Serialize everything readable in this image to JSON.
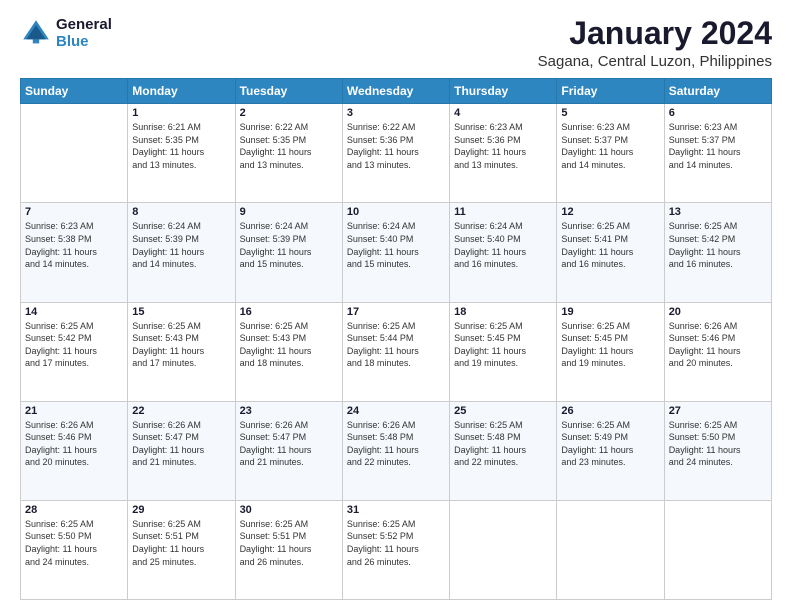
{
  "logo": {
    "line1": "General",
    "line2": "Blue"
  },
  "title": "January 2024",
  "subtitle": "Sagana, Central Luzon, Philippines",
  "days_header": [
    "Sunday",
    "Monday",
    "Tuesday",
    "Wednesday",
    "Thursday",
    "Friday",
    "Saturday"
  ],
  "weeks": [
    [
      {
        "num": "",
        "info": ""
      },
      {
        "num": "1",
        "info": "Sunrise: 6:21 AM\nSunset: 5:35 PM\nDaylight: 11 hours\nand 13 minutes."
      },
      {
        "num": "2",
        "info": "Sunrise: 6:22 AM\nSunset: 5:35 PM\nDaylight: 11 hours\nand 13 minutes."
      },
      {
        "num": "3",
        "info": "Sunrise: 6:22 AM\nSunset: 5:36 PM\nDaylight: 11 hours\nand 13 minutes."
      },
      {
        "num": "4",
        "info": "Sunrise: 6:23 AM\nSunset: 5:36 PM\nDaylight: 11 hours\nand 13 minutes."
      },
      {
        "num": "5",
        "info": "Sunrise: 6:23 AM\nSunset: 5:37 PM\nDaylight: 11 hours\nand 14 minutes."
      },
      {
        "num": "6",
        "info": "Sunrise: 6:23 AM\nSunset: 5:37 PM\nDaylight: 11 hours\nand 14 minutes."
      }
    ],
    [
      {
        "num": "7",
        "info": "Sunrise: 6:23 AM\nSunset: 5:38 PM\nDaylight: 11 hours\nand 14 minutes."
      },
      {
        "num": "8",
        "info": "Sunrise: 6:24 AM\nSunset: 5:39 PM\nDaylight: 11 hours\nand 14 minutes."
      },
      {
        "num": "9",
        "info": "Sunrise: 6:24 AM\nSunset: 5:39 PM\nDaylight: 11 hours\nand 15 minutes."
      },
      {
        "num": "10",
        "info": "Sunrise: 6:24 AM\nSunset: 5:40 PM\nDaylight: 11 hours\nand 15 minutes."
      },
      {
        "num": "11",
        "info": "Sunrise: 6:24 AM\nSunset: 5:40 PM\nDaylight: 11 hours\nand 16 minutes."
      },
      {
        "num": "12",
        "info": "Sunrise: 6:25 AM\nSunset: 5:41 PM\nDaylight: 11 hours\nand 16 minutes."
      },
      {
        "num": "13",
        "info": "Sunrise: 6:25 AM\nSunset: 5:42 PM\nDaylight: 11 hours\nand 16 minutes."
      }
    ],
    [
      {
        "num": "14",
        "info": "Sunrise: 6:25 AM\nSunset: 5:42 PM\nDaylight: 11 hours\nand 17 minutes."
      },
      {
        "num": "15",
        "info": "Sunrise: 6:25 AM\nSunset: 5:43 PM\nDaylight: 11 hours\nand 17 minutes."
      },
      {
        "num": "16",
        "info": "Sunrise: 6:25 AM\nSunset: 5:43 PM\nDaylight: 11 hours\nand 18 minutes."
      },
      {
        "num": "17",
        "info": "Sunrise: 6:25 AM\nSunset: 5:44 PM\nDaylight: 11 hours\nand 18 minutes."
      },
      {
        "num": "18",
        "info": "Sunrise: 6:25 AM\nSunset: 5:45 PM\nDaylight: 11 hours\nand 19 minutes."
      },
      {
        "num": "19",
        "info": "Sunrise: 6:25 AM\nSunset: 5:45 PM\nDaylight: 11 hours\nand 19 minutes."
      },
      {
        "num": "20",
        "info": "Sunrise: 6:26 AM\nSunset: 5:46 PM\nDaylight: 11 hours\nand 20 minutes."
      }
    ],
    [
      {
        "num": "21",
        "info": "Sunrise: 6:26 AM\nSunset: 5:46 PM\nDaylight: 11 hours\nand 20 minutes."
      },
      {
        "num": "22",
        "info": "Sunrise: 6:26 AM\nSunset: 5:47 PM\nDaylight: 11 hours\nand 21 minutes."
      },
      {
        "num": "23",
        "info": "Sunrise: 6:26 AM\nSunset: 5:47 PM\nDaylight: 11 hours\nand 21 minutes."
      },
      {
        "num": "24",
        "info": "Sunrise: 6:26 AM\nSunset: 5:48 PM\nDaylight: 11 hours\nand 22 minutes."
      },
      {
        "num": "25",
        "info": "Sunrise: 6:25 AM\nSunset: 5:48 PM\nDaylight: 11 hours\nand 22 minutes."
      },
      {
        "num": "26",
        "info": "Sunrise: 6:25 AM\nSunset: 5:49 PM\nDaylight: 11 hours\nand 23 minutes."
      },
      {
        "num": "27",
        "info": "Sunrise: 6:25 AM\nSunset: 5:50 PM\nDaylight: 11 hours\nand 24 minutes."
      }
    ],
    [
      {
        "num": "28",
        "info": "Sunrise: 6:25 AM\nSunset: 5:50 PM\nDaylight: 11 hours\nand 24 minutes."
      },
      {
        "num": "29",
        "info": "Sunrise: 6:25 AM\nSunset: 5:51 PM\nDaylight: 11 hours\nand 25 minutes."
      },
      {
        "num": "30",
        "info": "Sunrise: 6:25 AM\nSunset: 5:51 PM\nDaylight: 11 hours\nand 26 minutes."
      },
      {
        "num": "31",
        "info": "Sunrise: 6:25 AM\nSunset: 5:52 PM\nDaylight: 11 hours\nand 26 minutes."
      },
      {
        "num": "",
        "info": ""
      },
      {
        "num": "",
        "info": ""
      },
      {
        "num": "",
        "info": ""
      }
    ]
  ]
}
